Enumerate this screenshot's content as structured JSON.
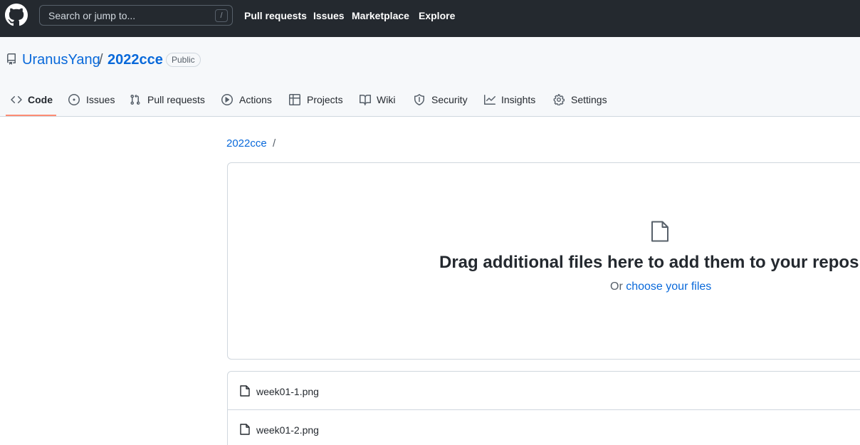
{
  "header": {
    "search_placeholder": "Search or jump to...",
    "search_key": "/",
    "nav": [
      "Pull requests",
      "Issues",
      "Marketplace",
      "Explore"
    ]
  },
  "repo": {
    "owner": "UranusYang",
    "separator": "/",
    "name": "2022cce",
    "visibility": "Public"
  },
  "tabs": [
    {
      "label": "Code",
      "icon": "code-icon",
      "selected": true
    },
    {
      "label": "Issues",
      "icon": "issue-icon"
    },
    {
      "label": "Pull requests",
      "icon": "pull-request-icon"
    },
    {
      "label": "Actions",
      "icon": "play-icon"
    },
    {
      "label": "Projects",
      "icon": "table-icon"
    },
    {
      "label": "Wiki",
      "icon": "book-icon"
    },
    {
      "label": "Security",
      "icon": "shield-icon"
    },
    {
      "label": "Insights",
      "icon": "graph-icon"
    },
    {
      "label": "Settings",
      "icon": "gear-icon"
    }
  ],
  "breadcrumb": {
    "repo": "2022cce",
    "separator": "/"
  },
  "dropzone": {
    "title": "Drag additional files here to add them to your repository",
    "prefix": "Or",
    "link": "choose your files"
  },
  "files": [
    {
      "name": "week01-1.png"
    },
    {
      "name": "week01-2.png"
    }
  ],
  "colors": {
    "header_bg": "#24292f",
    "link": "#0969da",
    "tab_underline": "#fd8c73"
  }
}
